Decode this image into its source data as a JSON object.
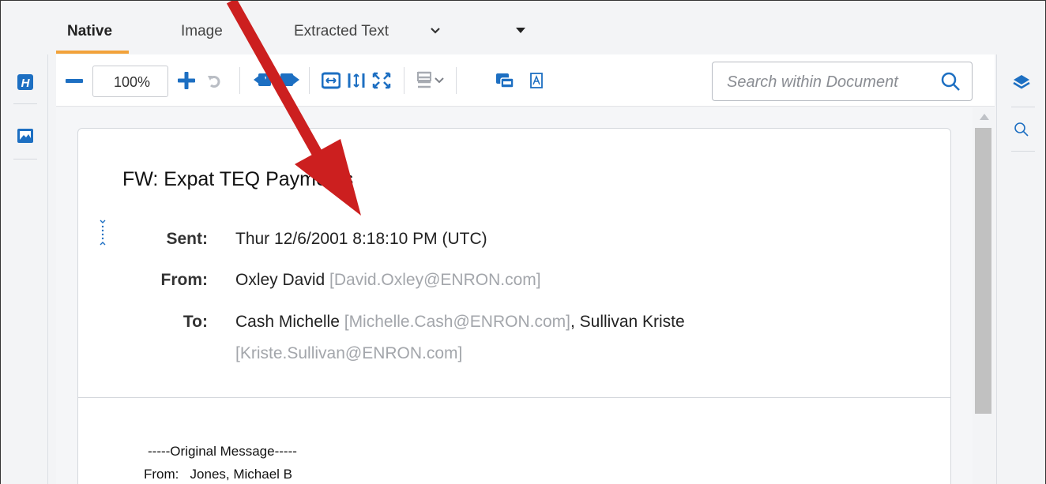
{
  "tabs": [
    {
      "label": "Native"
    },
    {
      "label": "Image"
    },
    {
      "label": "Extracted Text"
    }
  ],
  "toolbar": {
    "zoom_value": "100%",
    "search_placeholder": "Search within Document"
  },
  "left_rail": {
    "icons": [
      "highlight-icon",
      "image-icon"
    ]
  },
  "right_rail": {
    "icons": [
      "layers-icon",
      "search-icon"
    ]
  },
  "document": {
    "subject": "FW: Expat TEQ Payments",
    "sent_label": "Sent:",
    "sent_value": "Thur 12/6/2001 8:18:10 PM (UTC)",
    "from_label": "From:",
    "from_name": "Oxley David",
    "from_email": "[David.Oxley@ENRON.com]",
    "to_label": "To:",
    "to_name_1": "Cash Michelle",
    "to_email_1": "[Michelle.Cash@ENRON.com]",
    "to_sep": ",",
    "to_name_2": "Sullivan Kriste",
    "to_email_2": "[Kriste.Sullivan@ENRON.com]",
    "body_line_1": "-----Original Message-----",
    "body_line_2": "From:   Jones, Michael B"
  },
  "colors": {
    "accent_orange": "#f2a23a",
    "brand_blue": "#1d6fc2",
    "annotation_red": "#cc1f1f"
  }
}
